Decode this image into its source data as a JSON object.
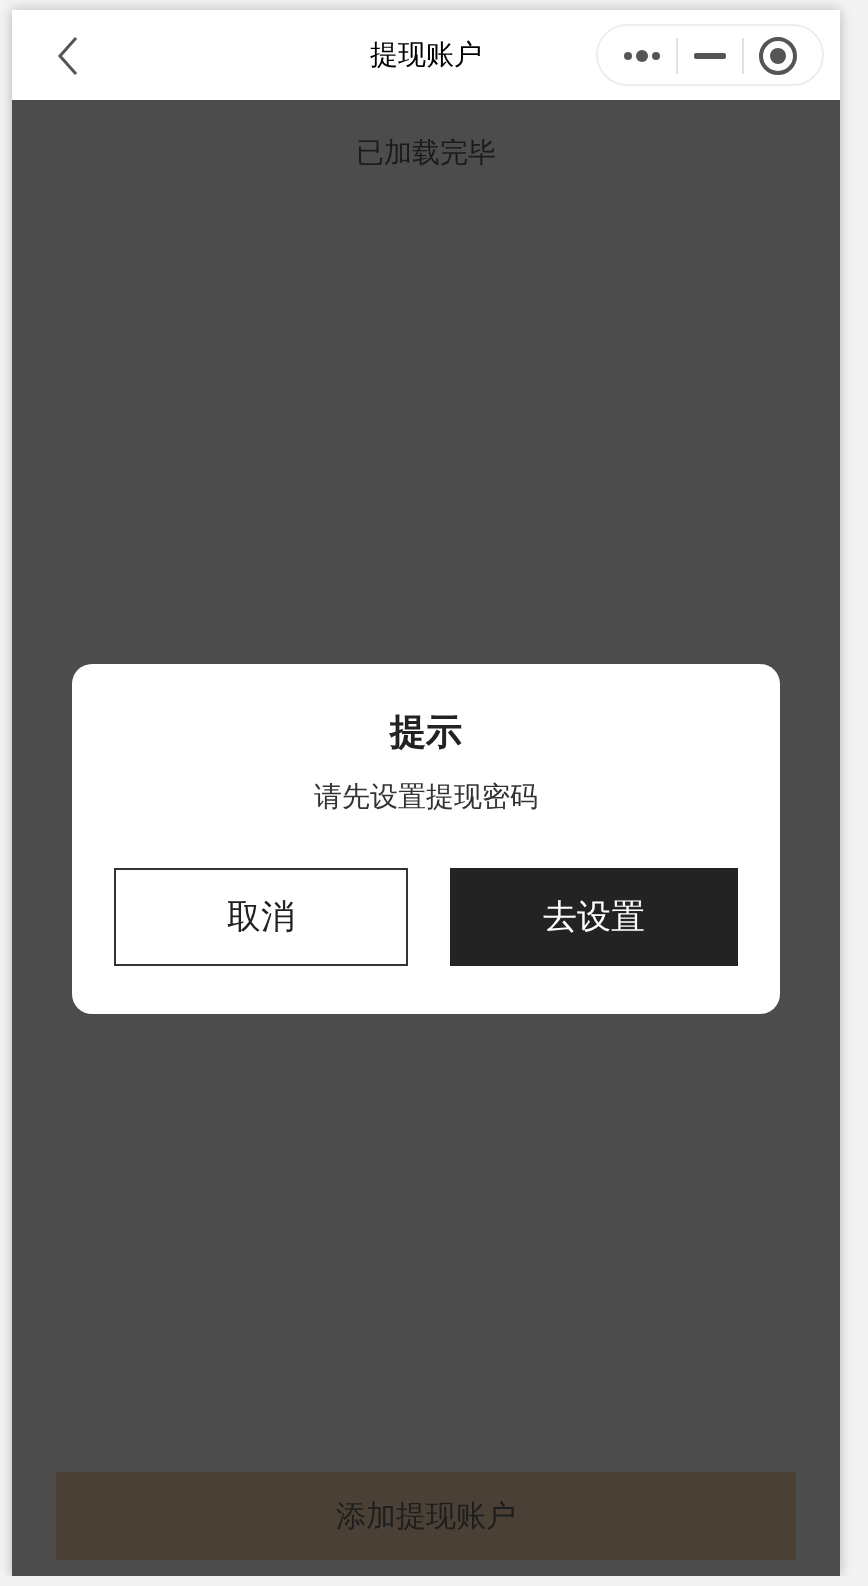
{
  "nav": {
    "title": "提现账户"
  },
  "page": {
    "status_text": "已加载完毕",
    "bottom_button": "添加提现账户"
  },
  "dialog": {
    "open": true,
    "title": "提示",
    "message": "请先设置提现密码",
    "buttons": [
      {
        "label": "取消",
        "kind": "secondary"
      },
      {
        "label": "去设置",
        "kind": "primary"
      }
    ]
  }
}
